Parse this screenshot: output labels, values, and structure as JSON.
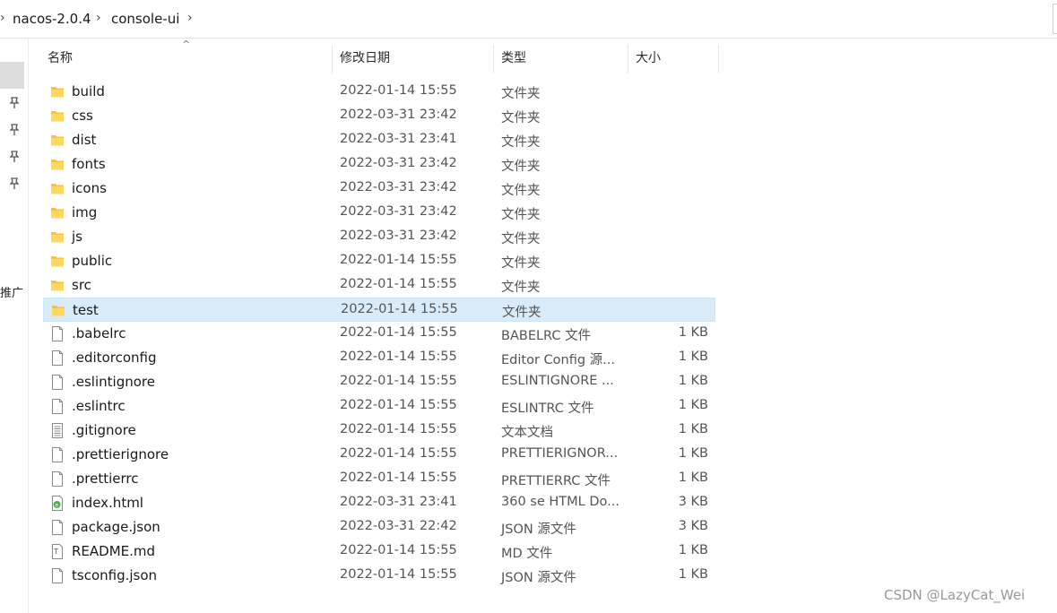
{
  "breadcrumb": {
    "items": [
      "nacos-2.0.4",
      "console-ui"
    ]
  },
  "nav": {
    "cut_labels": [
      "",
      "推广"
    ]
  },
  "columns": {
    "name": "名称",
    "date": "修改日期",
    "type": "类型",
    "size": "大小"
  },
  "files": [
    {
      "name": "build",
      "date": "2022-01-14 15:55",
      "type": "文件夹",
      "size": "",
      "icon": "folder-icon"
    },
    {
      "name": "css",
      "date": "2022-03-31 23:42",
      "type": "文件夹",
      "size": "",
      "icon": "folder-icon"
    },
    {
      "name": "dist",
      "date": "2022-03-31 23:41",
      "type": "文件夹",
      "size": "",
      "icon": "folder-icon"
    },
    {
      "name": "fonts",
      "date": "2022-03-31 23:42",
      "type": "文件夹",
      "size": "",
      "icon": "folder-icon"
    },
    {
      "name": "icons",
      "date": "2022-03-31 23:42",
      "type": "文件夹",
      "size": "",
      "icon": "folder-icon"
    },
    {
      "name": "img",
      "date": "2022-03-31 23:42",
      "type": "文件夹",
      "size": "",
      "icon": "folder-icon"
    },
    {
      "name": "js",
      "date": "2022-03-31 23:42",
      "type": "文件夹",
      "size": "",
      "icon": "folder-icon"
    },
    {
      "name": "public",
      "date": "2022-01-14 15:55",
      "type": "文件夹",
      "size": "",
      "icon": "folder-icon"
    },
    {
      "name": "src",
      "date": "2022-01-14 15:55",
      "type": "文件夹",
      "size": "",
      "icon": "folder-icon"
    },
    {
      "name": "test",
      "date": "2022-01-14 15:55",
      "type": "文件夹",
      "size": "",
      "icon": "folder-icon",
      "selected": true
    },
    {
      "name": ".babelrc",
      "date": "2022-01-14 15:55",
      "type": "BABELRC 文件",
      "size": "1 KB",
      "icon": "file-icon"
    },
    {
      "name": ".editorconfig",
      "date": "2022-01-14 15:55",
      "type": "Editor Config 源...",
      "size": "1 KB",
      "icon": "file-icon"
    },
    {
      "name": ".eslintignore",
      "date": "2022-01-14 15:55",
      "type": "ESLINTIGNORE ...",
      "size": "1 KB",
      "icon": "file-icon"
    },
    {
      "name": ".eslintrc",
      "date": "2022-01-14 15:55",
      "type": "ESLINTRC 文件",
      "size": "1 KB",
      "icon": "file-icon"
    },
    {
      "name": ".gitignore",
      "date": "2022-01-14 15:55",
      "type": "文本文档",
      "size": "1 KB",
      "icon": "text-file-icon"
    },
    {
      "name": ".prettierignore",
      "date": "2022-01-14 15:55",
      "type": "PRETTIERIGNOR...",
      "size": "1 KB",
      "icon": "file-icon"
    },
    {
      "name": ".prettierrc",
      "date": "2022-01-14 15:55",
      "type": "PRETTIERRC 文件",
      "size": "1 KB",
      "icon": "file-icon"
    },
    {
      "name": "index.html",
      "date": "2022-03-31 23:41",
      "type": "360 se HTML Do...",
      "size": "3 KB",
      "icon": "html-file-icon"
    },
    {
      "name": "package.json",
      "date": "2022-03-31 22:42",
      "type": "JSON 源文件",
      "size": "3 KB",
      "icon": "file-icon"
    },
    {
      "name": "README.md",
      "date": "2022-01-14 15:55",
      "type": "MD 文件",
      "size": "1 KB",
      "icon": "markdown-file-icon"
    },
    {
      "name": "tsconfig.json",
      "date": "2022-01-14 15:55",
      "type": "JSON 源文件",
      "size": "1 KB",
      "icon": "file-icon"
    }
  ],
  "watermark": "CSDN @LazyCat_Wei",
  "colors": {
    "folder": "#f5c342",
    "selection": "#d9ebf9",
    "html_icon": "#4caf50"
  }
}
